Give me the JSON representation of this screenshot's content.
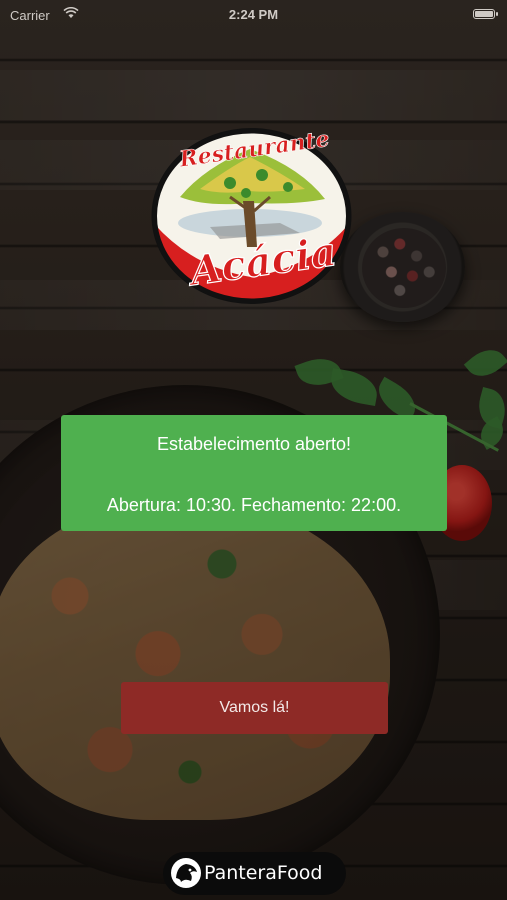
{
  "status_bar": {
    "carrier": "Carrier",
    "time": "2:24 PM"
  },
  "logo": {
    "line1": "Restaurante",
    "line2": "Acácia"
  },
  "info": {
    "status": "Estabelecimento aberto!",
    "hours": "Abertura: 10:30. Fechamento: 22:00."
  },
  "action": {
    "button_label": "Vamos lá!"
  },
  "footer": {
    "brand": "PanteraFood"
  },
  "colors": {
    "card": "#4fb04f",
    "button": "#8e2a26",
    "logo_red": "#d71f1f"
  }
}
